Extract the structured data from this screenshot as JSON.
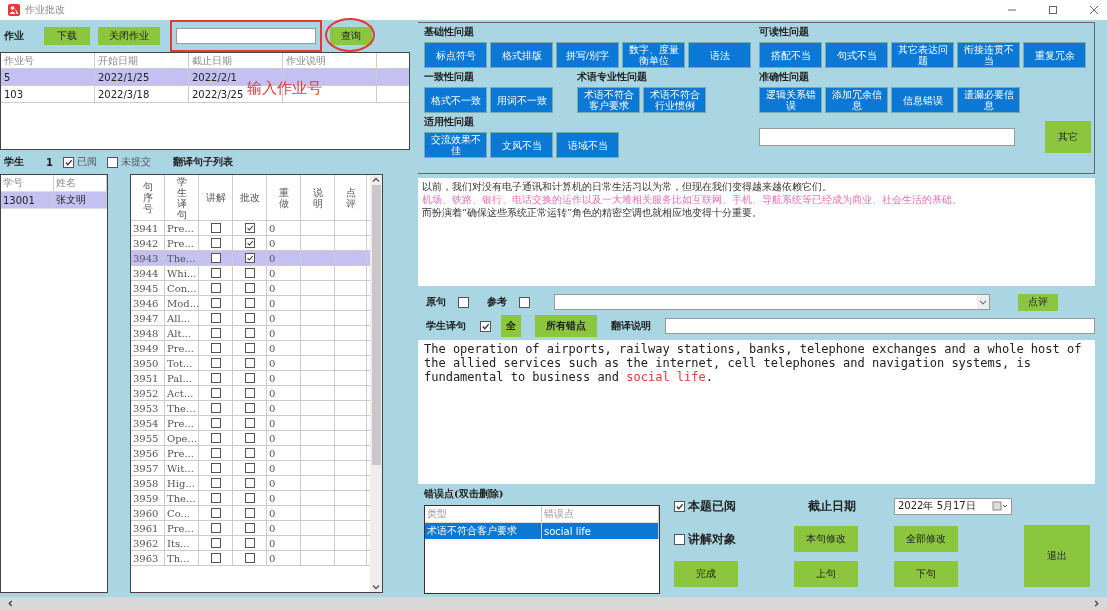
{
  "window": {
    "title": "作业批改"
  },
  "assignments": {
    "label": "作业",
    "buttons": [
      "下载",
      "关闭作业"
    ],
    "query_button": "查询",
    "annotation": "输入作业号",
    "columns": [
      "作业号",
      "开始日期",
      "截止日期",
      "作业说明"
    ],
    "rows": [
      {
        "cells": [
          "5",
          "2022/1/25",
          "2022/2/1"
        ],
        "selected": true
      },
      {
        "cells": [
          "103",
          "2022/3/18",
          "2022/3/25"
        ],
        "selected": false
      }
    ]
  },
  "students": {
    "label": "学生",
    "count": "1",
    "filters": [
      {
        "label": "已阅",
        "checked": true
      },
      {
        "label": "未提交",
        "checked": false
      }
    ],
    "list_title": "翻译句子列表",
    "columns": [
      "学号",
      "姓名"
    ],
    "rows": [
      {
        "cells": [
          "13001",
          "张文明"
        ],
        "selected": true
      }
    ]
  },
  "sentences": {
    "columns": [
      {
        "label": "句序号",
        "vertical": true
      },
      {
        "label": "学生译句",
        "vertical": true
      },
      {
        "label": "讲解",
        "vertical": false
      },
      {
        "label": "批改",
        "vertical": false
      },
      {
        "label": "重做",
        "vertical": true
      },
      {
        "label": "说明",
        "vertical": true
      },
      {
        "label": "点评",
        "vertical": true
      }
    ],
    "rows": [
      {
        "no": "3941",
        "text": "Pre...",
        "explain": false,
        "corrected": true,
        "redo": "0",
        "selected": false
      },
      {
        "no": "3942",
        "text": "Pre...",
        "explain": false,
        "corrected": true,
        "redo": "0",
        "selected": false
      },
      {
        "no": "3943",
        "text": "The...",
        "explain": false,
        "corrected": true,
        "redo": "0",
        "selected": true
      },
      {
        "no": "3944",
        "text": "Whi...",
        "explain": false,
        "corrected": false,
        "redo": "0",
        "selected": false
      },
      {
        "no": "3945",
        "text": "Con...",
        "explain": false,
        "corrected": false,
        "redo": "0",
        "selected": false
      },
      {
        "no": "3946",
        "text": "Mod...",
        "explain": false,
        "corrected": false,
        "redo": "0",
        "selected": false
      },
      {
        "no": "3947",
        "text": "All...",
        "explain": false,
        "corrected": false,
        "redo": "0",
        "selected": false
      },
      {
        "no": "3948",
        "text": "Alt...",
        "explain": false,
        "corrected": false,
        "redo": "0",
        "selected": false
      },
      {
        "no": "3949",
        "text": "Pre...",
        "explain": false,
        "corrected": false,
        "redo": "0",
        "selected": false
      },
      {
        "no": "3950",
        "text": "Tot...",
        "explain": false,
        "corrected": false,
        "redo": "0",
        "selected": false
      },
      {
        "no": "3951",
        "text": "Pal...",
        "explain": false,
        "corrected": false,
        "redo": "0",
        "selected": false
      },
      {
        "no": "3952",
        "text": "Act...",
        "explain": false,
        "corrected": false,
        "redo": "0",
        "selected": false
      },
      {
        "no": "3953",
        "text": "The...",
        "explain": false,
        "corrected": false,
        "redo": "0",
        "selected": false
      },
      {
        "no": "3954",
        "text": "Pre...",
        "explain": false,
        "corrected": false,
        "redo": "0",
        "selected": false
      },
      {
        "no": "3955",
        "text": "Ope...",
        "explain": false,
        "corrected": false,
        "redo": "0",
        "selected": false
      },
      {
        "no": "3956",
        "text": "Pre...",
        "explain": false,
        "corrected": false,
        "redo": "0",
        "selected": false
      },
      {
        "no": "3957",
        "text": "Wit...",
        "explain": false,
        "corrected": false,
        "redo": "0",
        "selected": false
      },
      {
        "no": "3958",
        "text": "Hig...",
        "explain": false,
        "corrected": false,
        "redo": "0",
        "selected": false
      },
      {
        "no": "3959",
        "text": "The...",
        "explain": false,
        "corrected": false,
        "redo": "0",
        "selected": false
      },
      {
        "no": "3960",
        "text": "Co...",
        "explain": false,
        "corrected": false,
        "redo": "0",
        "selected": false
      },
      {
        "no": "3961",
        "text": "Pre...",
        "explain": false,
        "corrected": false,
        "redo": "0",
        "selected": false
      },
      {
        "no": "3962",
        "text": "Its...",
        "explain": false,
        "corrected": false,
        "redo": "0",
        "selected": false
      },
      {
        "no": "3963",
        "text": "Th...",
        "explain": false,
        "corrected": false,
        "redo": "0",
        "selected": false
      }
    ]
  },
  "categories": {
    "groups": [
      {
        "title": "基础性问题",
        "items": [
          "标点符号",
          "格式排版",
          "拼写/别字",
          "数字、度量衡单位",
          "语法"
        ]
      },
      {
        "title": "一致性问题",
        "items": [
          "格式不一致",
          "用词不一致"
        ]
      },
      {
        "title": "术语专业性问题",
        "items": [
          "术语不符合客户要求",
          "术语不符合行业惯例"
        ]
      },
      {
        "title": "适用性问题",
        "items": [
          "交流效果不佳",
          "文风不当",
          "语域不当"
        ]
      },
      {
        "title": "可读性问题",
        "items": [
          "搭配不当",
          "句式不当",
          "其它表达问题",
          "衔接连贯不当",
          "重复冗余"
        ]
      },
      {
        "title": "准确性问题",
        "items": [
          "逻辑关系错误",
          "添加冗余信息",
          "信息错误",
          "遗漏必要信息"
        ]
      }
    ],
    "other_button": "其它"
  },
  "source": {
    "lines": [
      {
        "text": "以前，我们对没有电子通讯和计算机的日常生活习以为常，但现在我们变得越来越依赖它们。",
        "highlighted": false
      },
      {
        "text": "机场、铁路、银行、电话交换的运作以及一大堆相关服务比如互联网、手机、导航系统等已经成为商业、社会生活的基础。",
        "highlighted": true
      },
      {
        "text": "而扮演着“确保这些系统正常运转”角色的精密空调也就相应地变得十分重要。",
        "highlighted": false
      }
    ]
  },
  "source_options": [
    {
      "label": "原句",
      "checked": false
    },
    {
      "label": "参考",
      "checked": false
    }
  ],
  "comment_button": "点评",
  "student_row": {
    "label": "学生译句",
    "checked": true,
    "all_button": "全",
    "errors_button": "所有错点",
    "note_label": "翻译说明"
  },
  "translation": {
    "segments": [
      {
        "text": "The operation of airports, railway stations, banks, telephone exchanges and a whole host of the allied services such as the internet, cell telephones and navigation systems, is fundamental to business and ",
        "error": false
      },
      {
        "text": "social life",
        "error": true
      },
      {
        "text": ".",
        "error": false
      }
    ]
  },
  "errors": {
    "title": "错误点(双击删除)",
    "columns": [
      "类型",
      "错误点"
    ],
    "rows": [
      {
        "cells": [
          "术语不符合客户要求",
          "social life"
        ],
        "selected": true
      }
    ]
  },
  "review": {
    "reviewed": {
      "label": "本题已阅",
      "checked": true
    },
    "explain_target": {
      "label": "讲解对象",
      "checked": false
    },
    "deadline_label": "截止日期",
    "deadline": "2022年 5月17日",
    "buttons": [
      "完成",
      "本句修改",
      "上句",
      "全部修改",
      "下句",
      "退出"
    ]
  }
}
